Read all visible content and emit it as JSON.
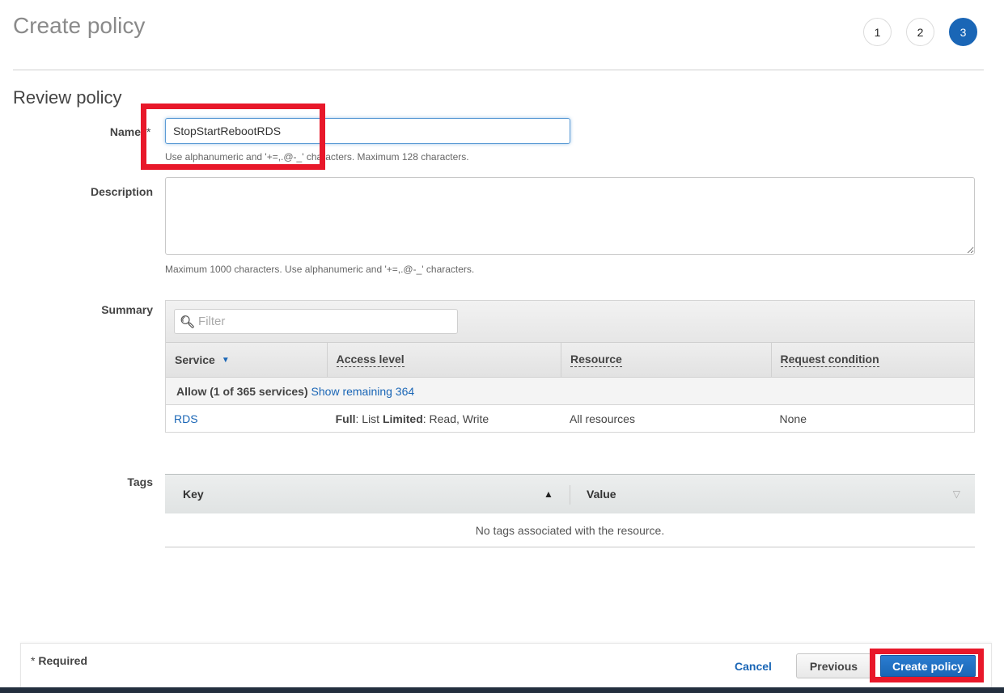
{
  "page": {
    "title": "Create policy",
    "steps": [
      {
        "label": "1",
        "active": false
      },
      {
        "label": "2",
        "active": false
      },
      {
        "label": "3",
        "active": true
      }
    ],
    "section_title": "Review policy"
  },
  "form": {
    "name": {
      "label": "Name",
      "required_mark": "*",
      "value": "StopStartRebootRDS",
      "hint": "Use alphanumeric and '+=,.@-_' characters. Maximum 128 characters."
    },
    "description": {
      "label": "Description",
      "value": "",
      "hint": "Maximum 1000 characters. Use alphanumeric and '+=,.@-_' characters."
    },
    "summary": {
      "label": "Summary",
      "filter_placeholder": "Filter",
      "columns": [
        "Service",
        "Access level",
        "Resource",
        "Request condition"
      ],
      "allow_group": {
        "label": "Allow (1 of 365 services)",
        "link": "Show remaining 364"
      },
      "rows": [
        {
          "service": "RDS",
          "access_full_label": "Full",
          "access_full_value": ": List ",
          "access_limited_label": "Limited",
          "access_limited_value": ": Read, Write",
          "resource": "All resources",
          "request_condition": "None"
        }
      ]
    },
    "tags": {
      "label": "Tags",
      "columns": [
        "Key",
        "Value"
      ],
      "empty_message": "No tags associated with the resource."
    }
  },
  "footer": {
    "required_note_star": "*",
    "required_note": "Required",
    "cancel_label": "Cancel",
    "previous_label": "Previous",
    "create_label": "Create policy"
  },
  "colors": {
    "accent": "#1a66b6",
    "highlight": "#e8182a",
    "bottom_bar": "#232f3e"
  }
}
